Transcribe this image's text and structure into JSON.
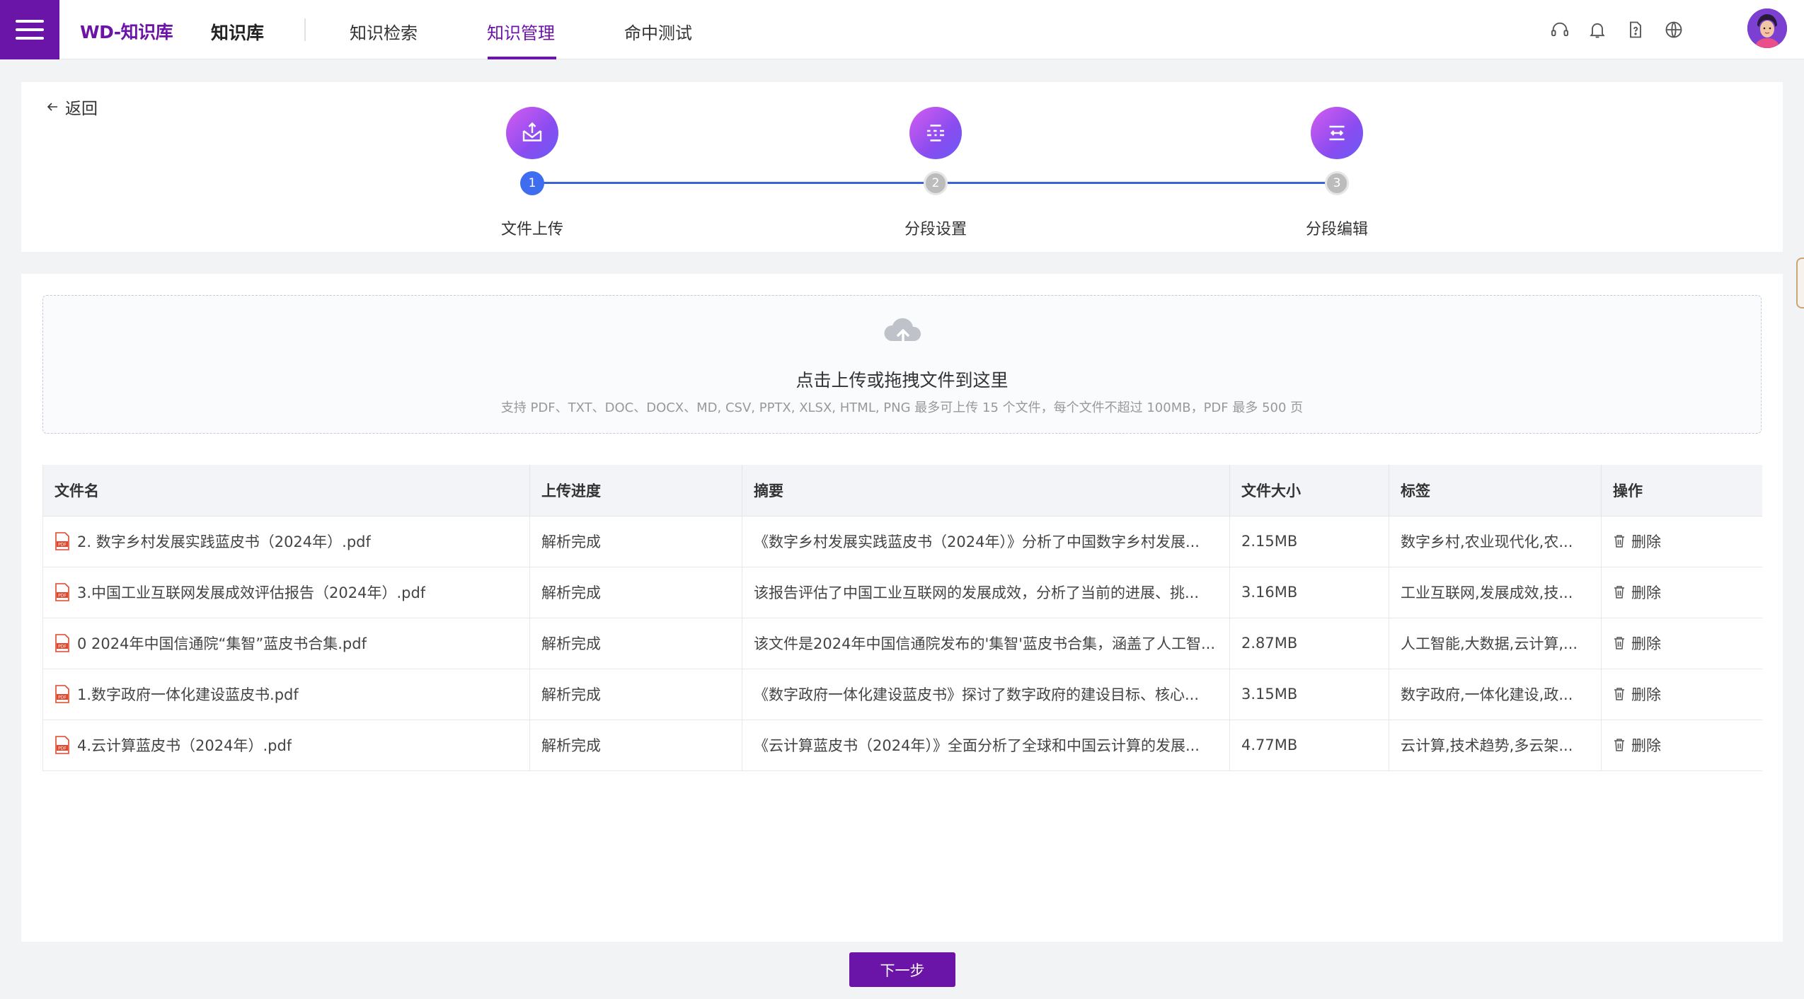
{
  "header": {
    "logo": "WD-知识库",
    "app_name": "知识库",
    "nav": [
      {
        "label": "知识检索",
        "active": false
      },
      {
        "label": "知识管理",
        "active": true
      },
      {
        "label": "命中测试",
        "active": false
      }
    ],
    "icons": [
      "headset-icon",
      "bell-icon",
      "help-doc-icon",
      "globe-icon"
    ]
  },
  "back_label": "返回",
  "steps": [
    {
      "index": "1",
      "label": "文件上传",
      "state": "done"
    },
    {
      "index": "2",
      "label": "分段设置",
      "state": "pending"
    },
    {
      "index": "3",
      "label": "分段编辑",
      "state": "pending"
    }
  ],
  "upload": {
    "title": "点击上传或拖拽文件到这里",
    "hint": "支持 PDF、TXT、DOC、DOCX、MD, CSV, PPTX, XLSX, HTML, PNG 最多可上传 15 个文件，每个文件不超过 100MB，PDF 最多 500 页"
  },
  "table": {
    "columns": [
      "文件名",
      "上传进度",
      "摘要",
      "文件大小",
      "标签",
      "操作"
    ],
    "rows": [
      {
        "name": "2. 数字乡村发展实践蓝皮书（2024年）.pdf",
        "progress": "解析完成",
        "summary": "《数字乡村发展实践蓝皮书（2024年）》分析了中国数字乡村发展...",
        "size": "2.15MB",
        "tags": "数字乡村,农业现代化,农...",
        "action": "删除"
      },
      {
        "name": "3.中国工业互联网发展成效评估报告（2024年）.pdf",
        "progress": "解析完成",
        "summary": "该报告评估了中国工业互联网的发展成效，分析了当前的进展、挑...",
        "size": "3.16MB",
        "tags": "工业互联网,发展成效,技...",
        "action": "删除"
      },
      {
        "name": "0 2024年中国信通院“集智”蓝皮书合集.pdf",
        "progress": "解析完成",
        "summary": "该文件是2024年中国信通院发布的'集智'蓝皮书合集，涵盖了人工智...",
        "size": "2.87MB",
        "tags": "人工智能,大数据,云计算,...",
        "action": "删除"
      },
      {
        "name": "1.数字政府一体化建设蓝皮书.pdf",
        "progress": "解析完成",
        "summary": "《数字政府一体化建设蓝皮书》探讨了数字政府的建设目标、核心...",
        "size": "3.15MB",
        "tags": "数字政府,一体化建设,政...",
        "action": "删除"
      },
      {
        "name": "4.云计算蓝皮书（2024年）.pdf",
        "progress": "解析完成",
        "summary": "《云计算蓝皮书（2024年）》全面分析了全球和中国云计算的发展...",
        "size": "4.77MB",
        "tags": "云计算,技术趋势,多云架...",
        "action": "删除"
      }
    ]
  },
  "next_button": "下一步",
  "colors": {
    "brand": "#6b14a8",
    "step_done": "#3f6df0",
    "step_pending": "#bcbcbc"
  }
}
